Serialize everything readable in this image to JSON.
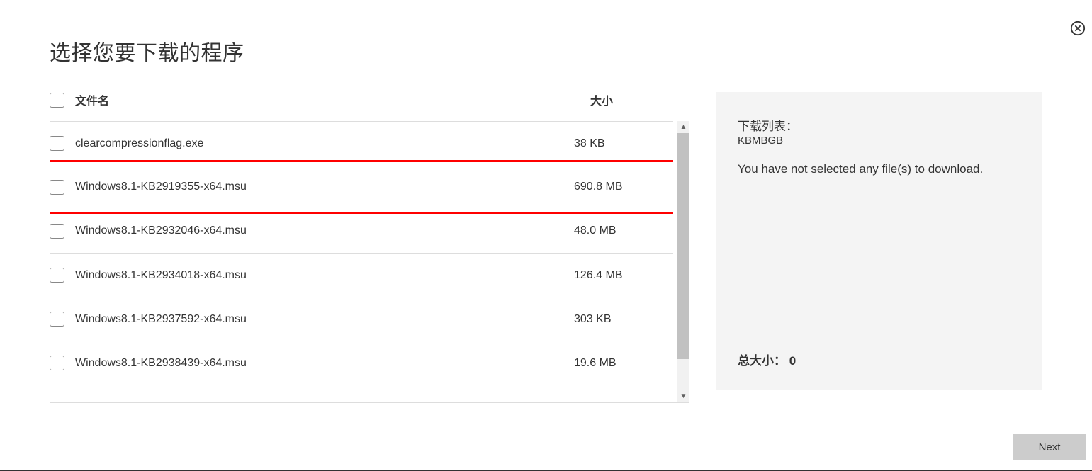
{
  "title": "选择您要下载的程序",
  "columns": {
    "filename": "文件名",
    "size": "大小"
  },
  "files": [
    {
      "name": "clearcompressionflag.exe",
      "size": "38 KB",
      "highlighted": false
    },
    {
      "name": "Windows8.1-KB2919355-x64.msu",
      "size": "690.8 MB",
      "highlighted": true
    },
    {
      "name": "Windows8.1-KB2932046-x64.msu",
      "size": "48.0 MB",
      "highlighted": false
    },
    {
      "name": "Windows8.1-KB2934018-x64.msu",
      "size": "126.4 MB",
      "highlighted": false
    },
    {
      "name": "Windows8.1-KB2937592-x64.msu",
      "size": "303 KB",
      "highlighted": false
    },
    {
      "name": "Windows8.1-KB2938439-x64.msu",
      "size": "19.6 MB",
      "highlighted": false
    }
  ],
  "side": {
    "download_list_label": "下载列表：",
    "units": "KBMBGB",
    "no_selection": "You have not selected any file(s) to download.",
    "total_label": "总大小：",
    "total_value": "0"
  },
  "buttons": {
    "next": "Next"
  }
}
